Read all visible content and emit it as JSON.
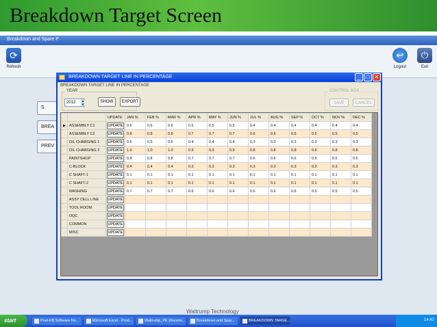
{
  "slide": {
    "title": "Breakdown Target Screen",
    "footer": "Waltrump Technology"
  },
  "app": {
    "title": "Breakdown and Spare P",
    "toolbar": {
      "refresh": "Refresh",
      "logout": "Logout",
      "exit": "Exit"
    },
    "side_buttons": [
      "S",
      "BREA",
      "PREV"
    ]
  },
  "dialog": {
    "title": "BREAKDOWN TARGET LINE IN PERCENTAGE",
    "subtitle": "BREAKDOWN TARGET LINE IN PERCENTAGE",
    "year_label": "YEAR",
    "year_value": "2012",
    "show_label": "SHOW",
    "export_label": "EXPORT",
    "control_box_label": "CONTROL BOX",
    "save_label": "SAVE",
    "cancel_label": "CANCEL",
    "row_marker": "▶",
    "update_label": "UPDATE",
    "columns": [
      "UPDATE",
      "JAN %",
      "FEB %",
      "MAR %",
      "APR %",
      "MAY %",
      "JUN %",
      "JUL %",
      "AUG %",
      "SEP %",
      "OCT %",
      "NOV %",
      "DEC %"
    ],
    "rows": [
      {
        "name": "ASSEMBLY C1",
        "values": [
          "0.6",
          "0.6",
          "0.6",
          "0.5",
          "0.5",
          "0.5",
          "0.4",
          "0.4",
          "0.4",
          "0.4",
          "0.4",
          "0.4"
        ]
      },
      {
        "name": "ASSEMBLY C2",
        "values": [
          "0.8",
          "0.8",
          "0.8",
          "0.7",
          "0.7",
          "0.7",
          "0.6",
          "0.6",
          "0.6",
          "0.5",
          "0.5",
          "0.5"
        ]
      },
      {
        "name": "OIL CHARGING 1",
        "values": [
          "0.5",
          "0.5",
          "0.5",
          "0.4",
          "0.4",
          "0.4",
          "0.3",
          "0.3",
          "0.3",
          "0.3",
          "0.3",
          "0.3"
        ]
      },
      {
        "name": "OIL CHARGING 2",
        "values": [
          "1.0",
          "1.0",
          "1.0",
          "0.9",
          "0.9",
          "0.9",
          "0.8",
          "0.8",
          "0.8",
          "0.8",
          "0.8",
          "0.8"
        ]
      },
      {
        "name": "PAINTSHOP",
        "values": [
          "0.8",
          "0.8",
          "0.8",
          "0.7",
          "0.7",
          "0.7",
          "0.6",
          "0.6",
          "0.6",
          "0.5",
          "0.5",
          "0.5"
        ]
      },
      {
        "name": "C-BLOCK",
        "values": [
          "0.4",
          "0.4",
          "0.4",
          "0.3",
          "0.3",
          "0.3",
          "0.3",
          "0.3",
          "0.3",
          "0.3",
          "0.3",
          "0.3"
        ]
      },
      {
        "name": "C SHAFT-1",
        "values": [
          "0.1",
          "0.1",
          "0.1",
          "0.1",
          "0.1",
          "0.1",
          "0.1",
          "0.1",
          "0.1",
          "0.1",
          "0.1",
          "0.1"
        ]
      },
      {
        "name": "C SHAFT-2",
        "values": [
          "0.1",
          "0.1",
          "0.1",
          "0.1",
          "0.1",
          "0.1",
          "0.1",
          "0.1",
          "0.1",
          "0.1",
          "0.1",
          "0.1"
        ]
      },
      {
        "name": "WASHING",
        "values": [
          "0.7",
          "0.7",
          "0.7",
          "0.6",
          "0.6",
          "0.6",
          "0.6",
          "0.6",
          "0.6",
          "0.5",
          "0.5",
          "0.5"
        ]
      },
      {
        "name": "ASSY CELL LINE",
        "values": [
          "",
          "",
          "",
          "",
          "",
          "",
          "",
          "",
          "",
          "",
          "",
          ""
        ]
      },
      {
        "name": "TOOL ROOM",
        "values": [
          "",
          "",
          "",
          "",
          "",
          "",
          "",
          "",
          "",
          "",
          "",
          ""
        ]
      },
      {
        "name": "OQC",
        "values": [
          "",
          "",
          "",
          "",
          "",
          "",
          "",
          "",
          "",
          "",
          "",
          ""
        ]
      },
      {
        "name": "COMMON",
        "values": [
          "",
          "",
          "",
          "",
          "",
          "",
          "",
          "",
          "",
          "",
          "",
          ""
        ]
      },
      {
        "name": "MISC",
        "values": [
          "",
          "",
          "",
          "",
          "",
          "",
          "",
          "",
          "",
          "",
          "",
          ""
        ]
      }
    ]
  },
  "taskbar": {
    "start": "start",
    "tasks": [
      "Post-KB Software No...",
      "Microsoft Excel - Prod...",
      "Waltrump_PE (Runnin...",
      "Breakdown and Spar...",
      "BREAKDOWN TARGE..."
    ],
    "clock": "14:42"
  },
  "colors": {
    "titlebar": "#0a3fd4",
    "alt_row": "#fde8cc",
    "header_green": "#3fa03f"
  }
}
